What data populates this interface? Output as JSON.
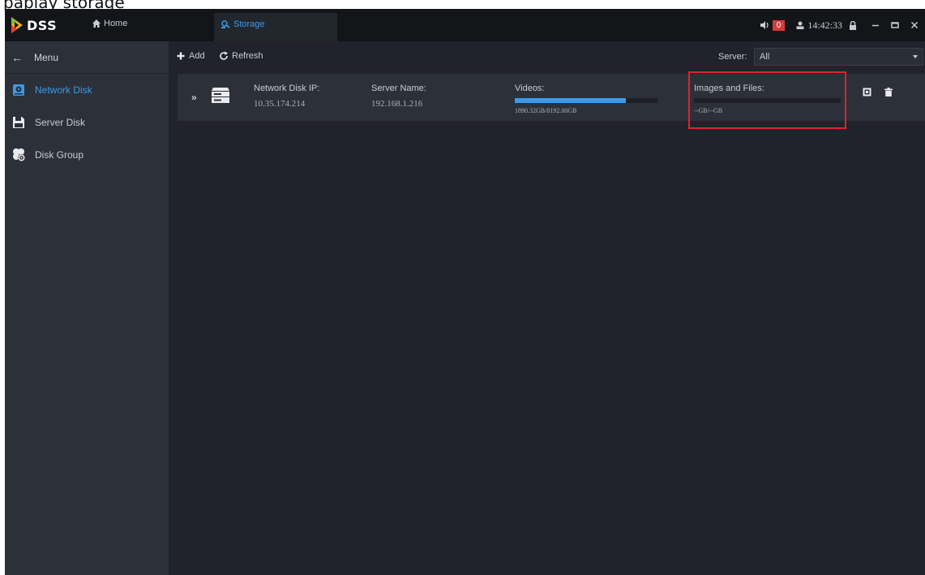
{
  "header_caption": "paplay storage",
  "app": {
    "logo_text": "DSS",
    "home_tab": "Home",
    "storage_tab": "Storage",
    "alarm_count": "0",
    "clock": "14:42:33"
  },
  "sidebar": {
    "menu_label": "Menu",
    "items": [
      {
        "label": "Network Disk",
        "icon": "network-disk-icon",
        "active": true
      },
      {
        "label": "Server Disk",
        "icon": "server-disk-icon",
        "active": false
      },
      {
        "label": "Disk Group",
        "icon": "disk-group-icon",
        "active": false
      }
    ]
  },
  "toolbar": {
    "add_label": "Add",
    "refresh_label": "Refresh",
    "server_label": "Server:",
    "server_value": "All"
  },
  "disk": {
    "ip_label": "Network Disk IP:",
    "ip_value": "10.35.174.214",
    "server_name_label": "Server Name:",
    "server_name_value": "192.168.1.216",
    "videos_label": "Videos:",
    "videos_capacity": "1890.32GB/8192.00GB",
    "videos_fill_fraction": 0.78,
    "images_label": "Images and Files:",
    "images_capacity": "--GB/--GB",
    "images_fill_fraction": 0
  },
  "colors": {
    "accent": "#3c9be8",
    "alarm": "#d73b3b",
    "highlight": "#e0232a"
  }
}
